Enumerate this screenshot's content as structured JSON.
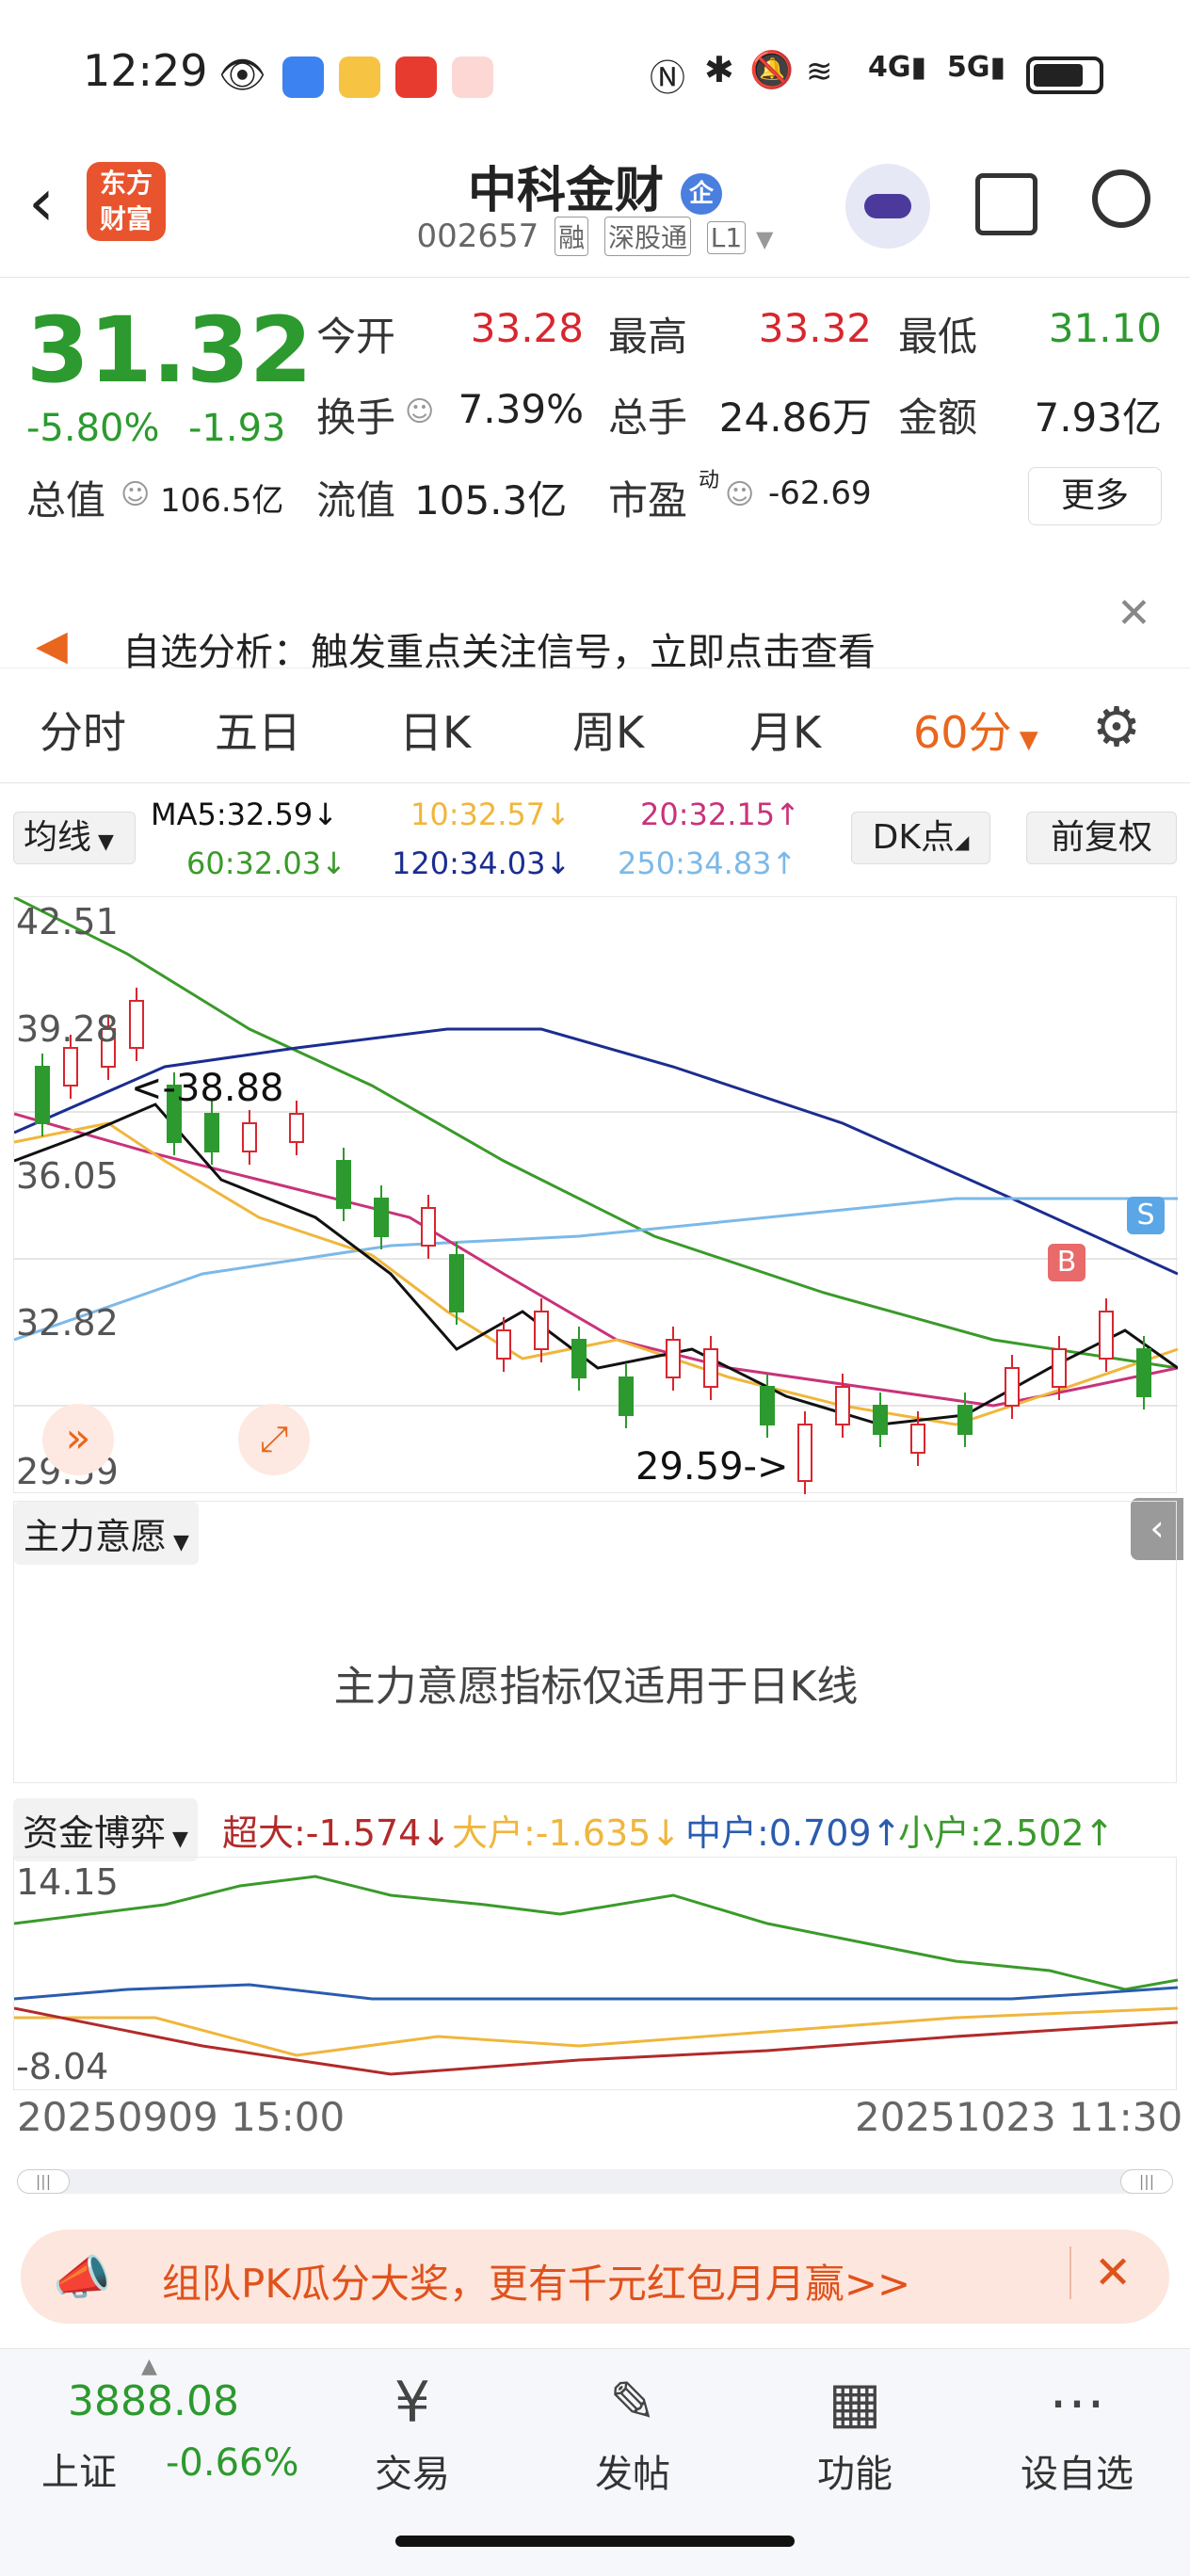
{
  "status_bar": {
    "time": "12:29"
  },
  "header": {
    "logo_line1": "东方",
    "logo_line2": "财富",
    "stock_name": "中科金财",
    "badge": "企",
    "code": "002657",
    "tags": [
      "融",
      "深股通",
      "L1"
    ]
  },
  "quote": {
    "price": "31.32",
    "change_pct": "-5.80%",
    "change_abs": "-1.93",
    "open_label": "今开",
    "open": "33.28",
    "high_label": "最高",
    "high": "33.32",
    "low_label": "最低",
    "low": "31.10",
    "turnover_label": "换手",
    "turnover": "7.39%",
    "volume_label": "总手",
    "volume": "24.86万",
    "amount_label": "金额",
    "amount": "7.93亿",
    "mcap_label": "总值",
    "mcap": "106.5亿",
    "float_label": "流值",
    "float": "105.3亿",
    "pe_label": "市盈",
    "pe_sup": "动",
    "pe": "-62.69",
    "more": "更多"
  },
  "notice": {
    "text": "自选分析：触发重点关注信号，立即点击查看"
  },
  "tabs": [
    "分时",
    "五日",
    "日K",
    "周K",
    "月K",
    "60分"
  ],
  "active_tab": "60分",
  "ma": {
    "selector": "均线",
    "ma5": "MA5:32.59↓",
    "ma10": "10:32.57↓",
    "ma20": "20:32.15↑",
    "ma60": "60:32.03↓",
    "ma120": "120:34.03↓",
    "ma250": "250:34.83↑",
    "dk": "DK点",
    "adjust": "前复权"
  },
  "kchart": {
    "y_labels": [
      "42.51",
      "39.28",
      "36.05",
      "32.82",
      "29.59"
    ],
    "high_marker": "<-38.88",
    "low_marker": "29.59->",
    "buy_label": "B",
    "sell_label": "S"
  },
  "indicator2": {
    "selector": "主力意愿",
    "message": "主力意愿指标仅适用于日K线"
  },
  "indicator3": {
    "selector": "资金博弈",
    "super": "超大:-1.574↓",
    "big": "大户:-1.635↓",
    "mid": "中户:0.709↑",
    "small": "小户:2.502↑",
    "y_top": "14.15",
    "y_bottom": "-8.04",
    "date_start": "20250909 15:00",
    "date_end": "20251023 11:30"
  },
  "colors": {
    "up": "#d8262f",
    "down": "#2c9a2e",
    "accent": "#e9661e",
    "ma5": "#111111",
    "ma10": "#f0b63c",
    "ma20": "#c8337a",
    "ma60": "#3a9a2a",
    "ma120": "#1b2d8f",
    "ma250": "#7cb9e8"
  },
  "promo": {
    "text": "组队PK瓜分大奖，更有千元红包月月赢>>"
  },
  "bottom_nav": {
    "index_value": "3888.08",
    "index_name": "上证",
    "index_change": "-0.66%",
    "items": [
      "交易",
      "发帖",
      "功能",
      "设自选"
    ]
  }
}
